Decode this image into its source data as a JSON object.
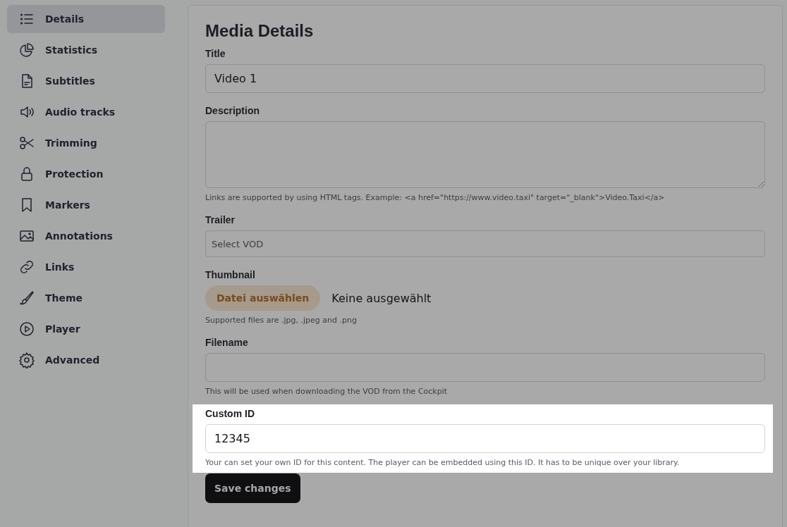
{
  "sidebar": {
    "items": [
      {
        "label": "Details",
        "selected": true
      },
      {
        "label": "Statistics",
        "selected": false
      },
      {
        "label": "Subtitles",
        "selected": false
      },
      {
        "label": "Audio tracks",
        "selected": false
      },
      {
        "label": "Trimming",
        "selected": false
      },
      {
        "label": "Protection",
        "selected": false
      },
      {
        "label": "Markers",
        "selected": false
      },
      {
        "label": "Annotations",
        "selected": false
      },
      {
        "label": "Links",
        "selected": false
      },
      {
        "label": "Theme",
        "selected": false
      },
      {
        "label": "Player",
        "selected": false
      },
      {
        "label": "Advanced",
        "selected": false
      }
    ]
  },
  "form": {
    "title": "Media Details",
    "fields": [
      {
        "kind": "text",
        "label": "Title",
        "value": "Video 1",
        "highlighted": false
      },
      {
        "kind": "textarea",
        "label": "Description",
        "help": "Links are supported by using HTML tags. Example: <a href=\"https://www.video.taxi\" target=\"_blank\">Video.Taxi</a>",
        "highlighted": false
      },
      {
        "kind": "select",
        "label": "Trailer",
        "placeholder": "Select VOD",
        "highlighted": false
      },
      {
        "kind": "file",
        "label": "Thumbnail",
        "button": "Datei auswählen",
        "status": "Keine ausgewählt",
        "help": "Supported files are .jpg, .jpeg and .png",
        "highlighted": false
      },
      {
        "kind": "text",
        "label": "Filename",
        "help": "This will be used when downloading the VOD from the Cockpit",
        "highlighted": false
      },
      {
        "kind": "text",
        "label": "Custom ID",
        "value": "12345",
        "help": "Your can set your own ID for this content. The player can be embedded using this ID. It has to be unique over your library.",
        "highlighted": true
      }
    ],
    "save_button": "Save changes"
  }
}
